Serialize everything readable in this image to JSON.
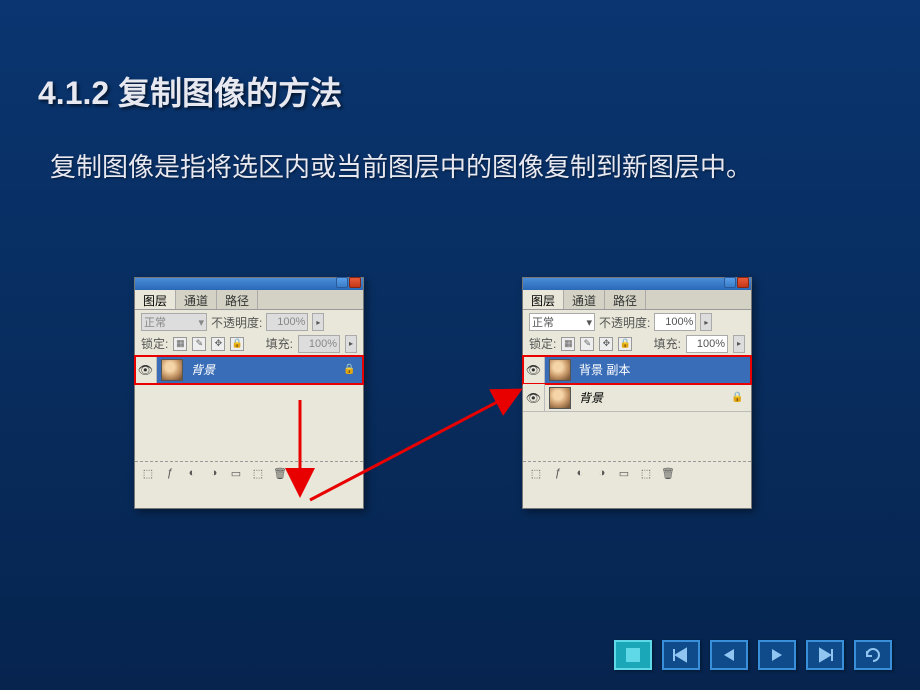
{
  "title": "4.1.2  复制图像的方法",
  "description": "复制图像是指将选区内或当前图层中的图像复制到新图层中。",
  "panel": {
    "tabs": {
      "layers": "图层",
      "channels": "通道",
      "paths": "路径"
    },
    "blend_mode": "正常",
    "opacity_label": "不透明度:",
    "opacity_value": "100%",
    "lock_label": "锁定:",
    "fill_label": "填充:",
    "fill_value": "100%"
  },
  "left_panel": {
    "layers": [
      {
        "name": "背景",
        "selected": true,
        "italic": true,
        "locked": true
      }
    ]
  },
  "right_panel": {
    "layers": [
      {
        "name": "背景 副本",
        "selected": true,
        "italic": false,
        "locked": false
      },
      {
        "name": "背景",
        "selected": false,
        "italic": true,
        "locked": true
      }
    ]
  },
  "nav": {
    "home": "■",
    "first": "|◀",
    "prev": "◀",
    "next": "▶",
    "last": "▶|",
    "return": "↶"
  }
}
